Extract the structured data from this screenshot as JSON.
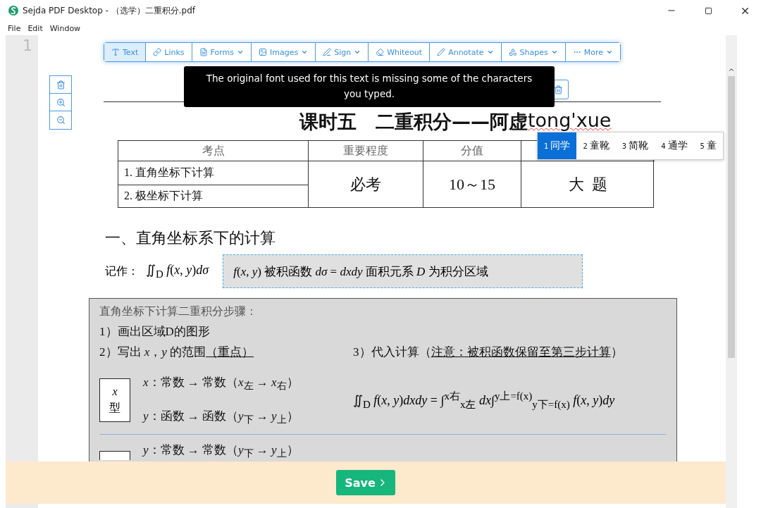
{
  "window": {
    "title": "Sejda PDF Desktop - （选学）二重积分.pdf"
  },
  "menu": [
    "File",
    "Edit",
    "Window"
  ],
  "page_number": "1",
  "toolbar": [
    {
      "label": "Text",
      "selected": true,
      "dropdown": false
    },
    {
      "label": "Links",
      "selected": false,
      "dropdown": false
    },
    {
      "label": "Forms",
      "selected": false,
      "dropdown": true
    },
    {
      "label": "Images",
      "selected": false,
      "dropdown": true
    },
    {
      "label": "Sign",
      "selected": false,
      "dropdown": true
    },
    {
      "label": "Whiteout",
      "selected": false,
      "dropdown": false
    },
    {
      "label": "Annotate",
      "selected": false,
      "dropdown": true
    },
    {
      "label": "Shapes",
      "selected": false,
      "dropdown": true
    },
    {
      "label": "More",
      "selected": false,
      "dropdown": true
    }
  ],
  "tooltip": "The original font used for this text is missing some of the characters you typed.",
  "ime_candidates": [
    {
      "number": "1",
      "text": "同学",
      "selected": true
    },
    {
      "number": "2",
      "text": "童靴",
      "selected": false
    },
    {
      "number": "3",
      "text": "简靴",
      "selected": false
    },
    {
      "number": "4",
      "text": "通学",
      "selected": false
    },
    {
      "number": "5",
      "text": "童",
      "selected": false
    }
  ],
  "document": {
    "title": "课时五　二重积分——阿虚",
    "title_editing": "tong'xue",
    "table": {
      "columns": [
        "考点",
        "重要程度",
        "分值"
      ],
      "topics": [
        "1. 直角坐标下计算",
        "2. 极坐标下计算"
      ],
      "importance": "必考",
      "score": "10～15",
      "type": "大  题"
    },
    "heading": "一、直角坐标系下的计算",
    "notation_label": "记作：",
    "notation": "∬$_{D}$ *f*(*x*, *y*)*dσ*",
    "selected_text": "*f*(*x*, *y*)  被积函数  *dσ* = *dxdy* 面积元系  *D* 为积分区域",
    "steps": {
      "intro": "直角坐标下计算二重积分步骤：",
      "step1": "1）画出区域D的图形",
      "step2": "2）写出 *x*，*y* 的范围",
      "step2_underlined": "（重点）",
      "step3": "3）代入计算（",
      "step3_underlined": "注意：被积函数保留至第三步计算",
      "step3_end": "）",
      "x_type": {
        "variable": "x",
        "label": "型",
        "lines": [
          "*x*：常数 → 常数（*x*$_{左}$ → *x*$_{右}$）",
          "*y*：函数 → 函数（*y*$_{下}$ → *y*$_{上}$）"
        ],
        "formula": "∬$_{D}$ *f*(*x*, *y*)*dxdy* = ∫$^{x右}$$_{x左}$ *dx*∫$^{y上=f(x)}$$_{y下=f(x)}$ *f*(*x*, *y*)*dy*"
      },
      "y_type_line": "*y*：常数 → 常数（*y*$_{下}$ → *y*$_{上}$）"
    }
  },
  "save_button": "Save"
}
